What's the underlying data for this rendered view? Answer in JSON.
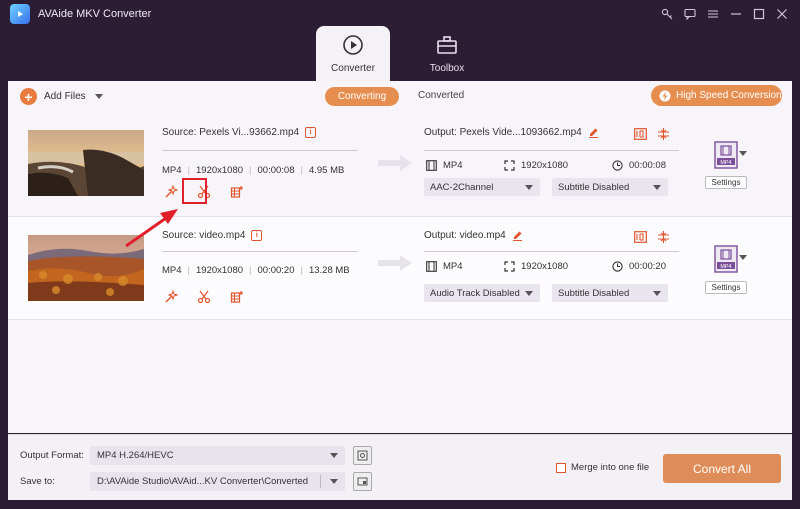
{
  "window": {
    "title": "AVAide MKV Converter",
    "controls": [
      "key-icon",
      "chat-icon",
      "menu-icon",
      "minimize-icon",
      "maximize-icon",
      "close-icon"
    ]
  },
  "tabs": [
    {
      "label": "Converter",
      "icon": "converter-icon",
      "active": true
    },
    {
      "label": "Toolbox",
      "icon": "toolbox-icon",
      "active": false
    }
  ],
  "toolbar": {
    "add_files": "Add Files",
    "converting": "Converting",
    "converted": "Converted",
    "high_speed": "High Speed Conversion"
  },
  "files": [
    {
      "source": "Source: Pexels Vi...93662.mp4",
      "format": "MP4",
      "resolution": "1920x1080",
      "duration": "00:00:08",
      "size": "4.95 MB",
      "output": "Output: Pexels Vide...1093662.mp4",
      "out_format": "MP4",
      "out_resolution": "1920x1080",
      "out_duration": "00:00:08",
      "audio": "AAC-2Channel",
      "subtitle": "Subtitle Disabled",
      "format_badge": "MP4",
      "settings": "Settings"
    },
    {
      "source": "Source: video.mp4",
      "format": "MP4",
      "resolution": "1920x1080",
      "duration": "00:00:20",
      "size": "13.28 MB",
      "output": "Output: video.mp4",
      "out_format": "MP4",
      "out_resolution": "1920x1080",
      "out_duration": "00:00:20",
      "audio": "Audio Track Disabled",
      "subtitle": "Subtitle Disabled",
      "format_badge": "MP4",
      "settings": "Settings"
    }
  ],
  "bottom": {
    "output_format_label": "Output Format:",
    "output_format_value": "MP4 H.264/HEVC",
    "save_to_label": "Save to:",
    "save_to_value": "D:\\AVAide Studio\\AVAid...KV Converter\\Converted",
    "merge_label": "Merge into one file",
    "convert_all": "Convert All"
  },
  "colors": {
    "accent": "#e58e4f",
    "titlebar": "#2b1e34",
    "highlight": "#e0202a"
  }
}
